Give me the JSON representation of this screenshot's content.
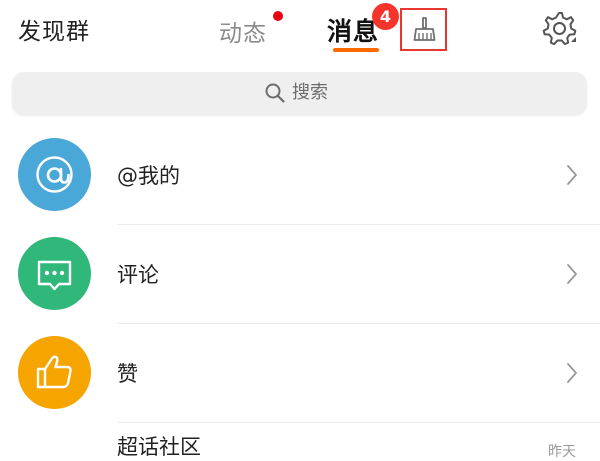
{
  "header": {
    "left_link": "发现群",
    "tabs": [
      {
        "label": "动态",
        "has_dot": true
      },
      {
        "label": "消息",
        "active": true,
        "badge": "4"
      }
    ],
    "clean_icon": "broom-icon",
    "settings_icon": "gear-icon"
  },
  "search": {
    "icon": "search-icon",
    "label": "搜索"
  },
  "list": [
    {
      "label": "@我的",
      "icon": "at-icon",
      "color": "#4aa8d8"
    },
    {
      "label": "评论",
      "icon": "comment-icon",
      "color": "#2fb87a"
    },
    {
      "label": "赞",
      "icon": "thumbs-up-icon",
      "color": "#f6a400"
    },
    {
      "label": "超话社区",
      "time": "昨天",
      "partial": true
    }
  ],
  "colors": {
    "accent": "#ff6a00",
    "badge": "#f5352b",
    "highlight_box": "#e8382e"
  }
}
